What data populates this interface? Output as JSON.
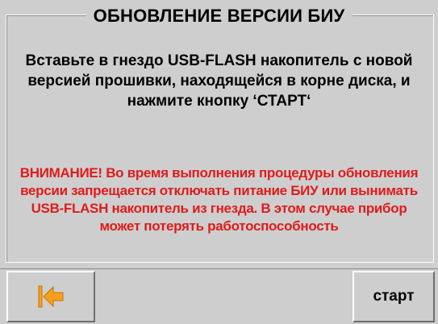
{
  "dialog": {
    "title": "ОБНОВЛЕНИЕ ВЕРСИИ БИУ",
    "instruction": "Вставьте в гнездо USB-FLASH накопитель с новой\nверсией прошивки, находящейся в корне диска, и\nнажмите кнопку ‘СТАРТ‘",
    "warning": "ВНИМАНИЕ! Во время выполнения процедуры обновления\nверсии запрещается отключать питание БИУ или вынимать\nUSB-FLASH накопитель из гнезда. В этом случае прибор\nможет потерять работоспособность"
  },
  "buttons": {
    "back_icon": "back-to-start-icon",
    "start_label": "старт"
  },
  "colors": {
    "background": "#cecece",
    "warning_text": "#e01b1b",
    "back_icon_fill": "#f7a01c"
  }
}
